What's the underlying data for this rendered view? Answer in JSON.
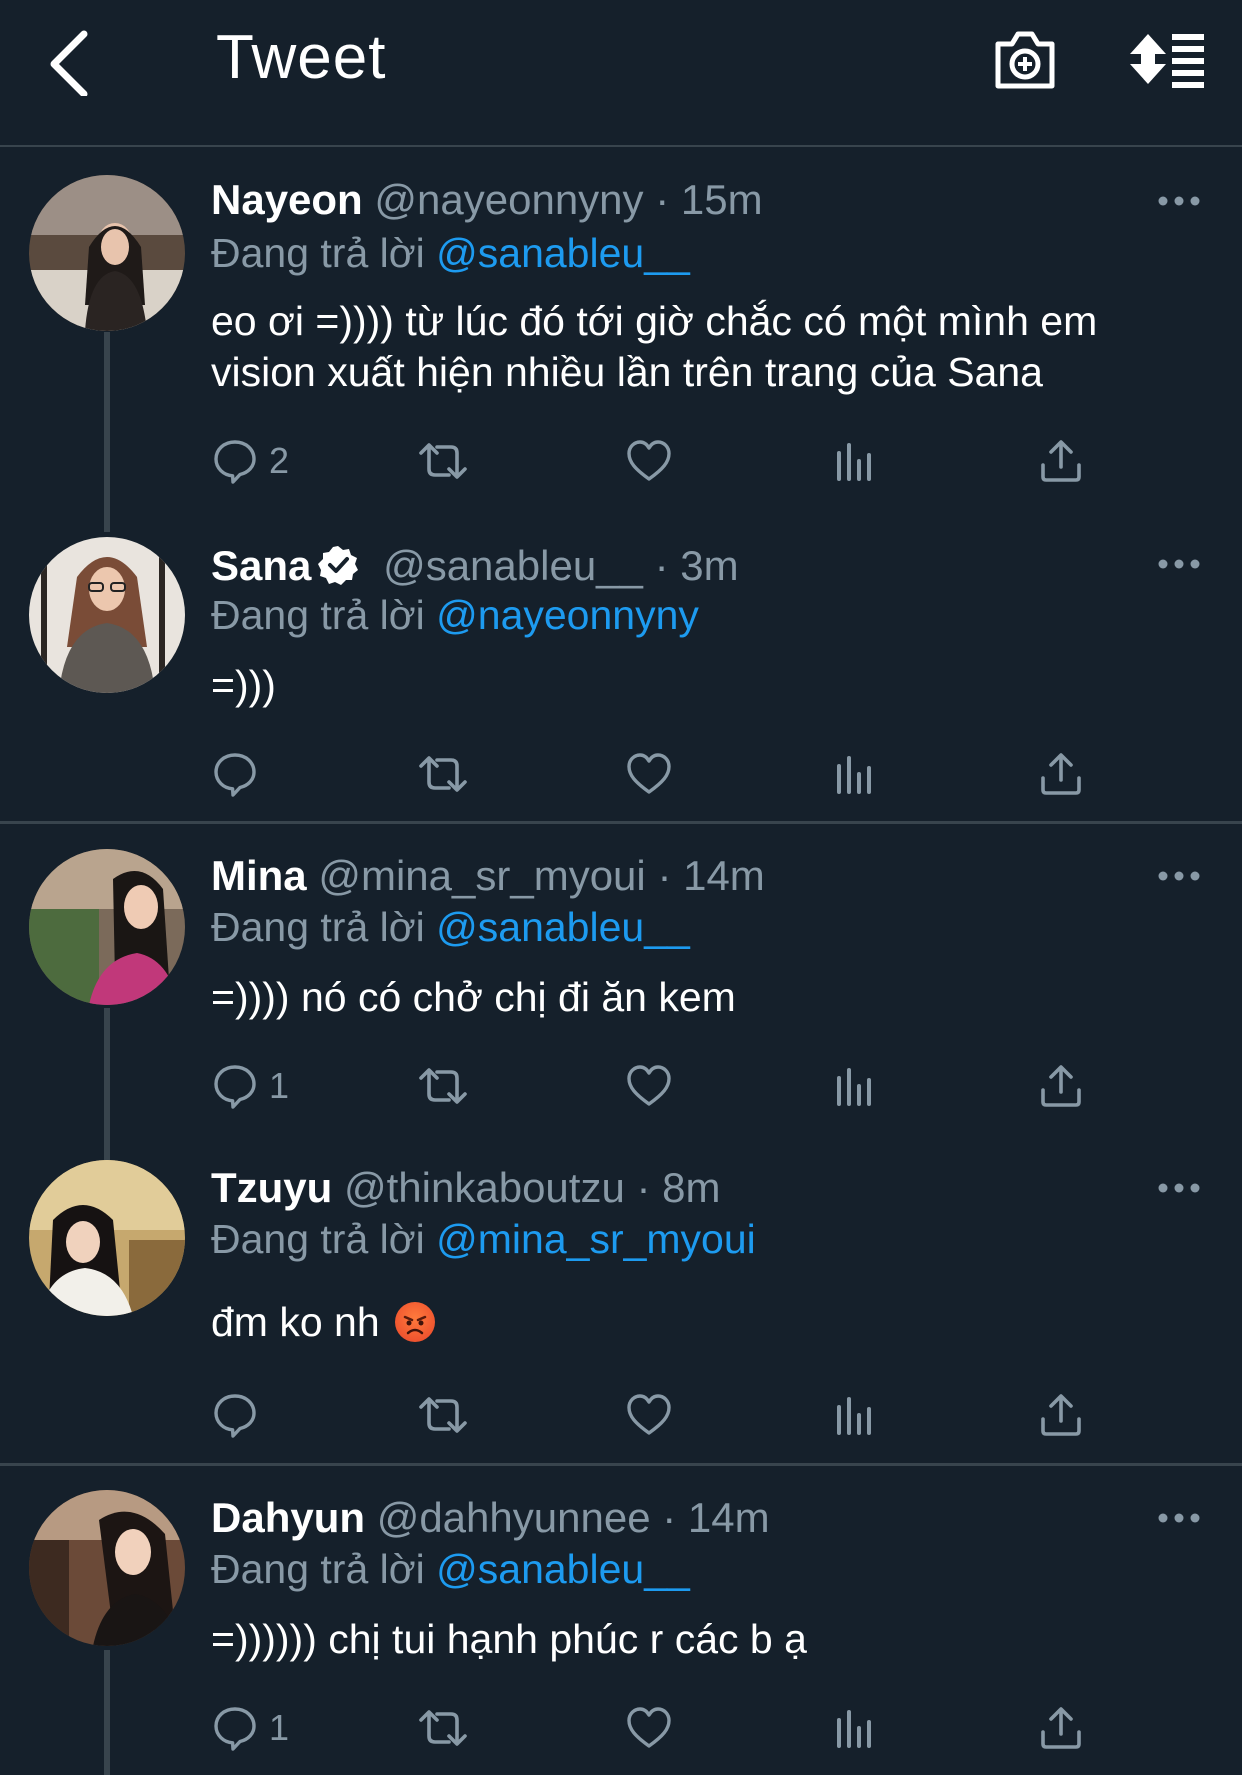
{
  "header": {
    "title": "Tweet"
  },
  "colors": {
    "background": "#15202b",
    "accent": "#1d9bf0",
    "muted": "#8899a6",
    "divider": "#38444d"
  },
  "tweets": [
    {
      "name": "Nayeon",
      "handle": "@nayeonnyny",
      "time": "· 15m",
      "replying_label": "Đang trả lời",
      "replying_to": "@sanableu__",
      "text": "eo ơi =)))) từ lúc đó tới giờ chắc có một mình em vision xuất hiện nhiều lần trên trang của Sana",
      "reply_count": "2",
      "verified": false
    },
    {
      "name": "Sana",
      "handle": "@sanableu__",
      "time": "· 3m",
      "replying_label": "Đang trả lời",
      "replying_to": "@nayeonnyny",
      "text": "=)))",
      "reply_count": "",
      "verified": true
    },
    {
      "name": "Mina",
      "handle": "@mina_sr_myoui",
      "time": "· 14m",
      "replying_label": "Đang trả lời",
      "replying_to": "@sanableu__",
      "text": "=)))) nó có chở chị đi ăn kem",
      "reply_count": "1",
      "verified": false
    },
    {
      "name": "Tzuyu",
      "handle": "@thinkaboutzu",
      "time": "· 8m",
      "replying_label": "Đang trả lời",
      "replying_to": "@mina_sr_myoui",
      "text": "đm ko nh",
      "emoji": "angry-face",
      "reply_count": "",
      "verified": false
    },
    {
      "name": "Dahyun",
      "handle": "@dahhyunnee",
      "time": "· 14m",
      "replying_label": "Đang trả lời",
      "replying_to": "@sanableu__",
      "text": "=)))))) chị tui hạnh phúc r các b ạ",
      "reply_count": "1",
      "verified": false
    }
  ]
}
